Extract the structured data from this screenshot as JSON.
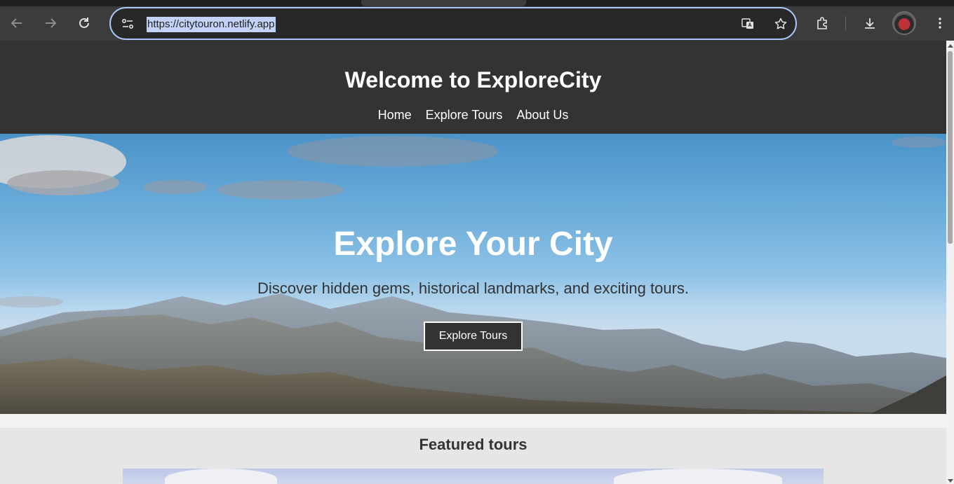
{
  "browser": {
    "url": "https://citytouron.netlify.app",
    "icons": [
      "back-arrow-icon",
      "forward-arrow-icon",
      "reload-icon",
      "site-settings-icon",
      "translate-icon",
      "bookmark-star-icon",
      "extensions-icon",
      "download-icon",
      "profile-avatar",
      "more-menu-icon"
    ]
  },
  "site": {
    "title": "Welcome to ExploreCity",
    "nav": [
      "Home",
      "Explore Tours",
      "About Us"
    ]
  },
  "hero": {
    "title": "Explore Your City",
    "subtitle": "Discover hidden gems, historical landmarks, and exciting tours.",
    "cta": "Explore Tours"
  },
  "featured": {
    "title": "Featured tours"
  },
  "colors": {
    "header_bg": "#333333",
    "button_bg": "#333333",
    "featured_bg": "#e6e6e6",
    "omnibox_border": "#a8c7fa"
  }
}
